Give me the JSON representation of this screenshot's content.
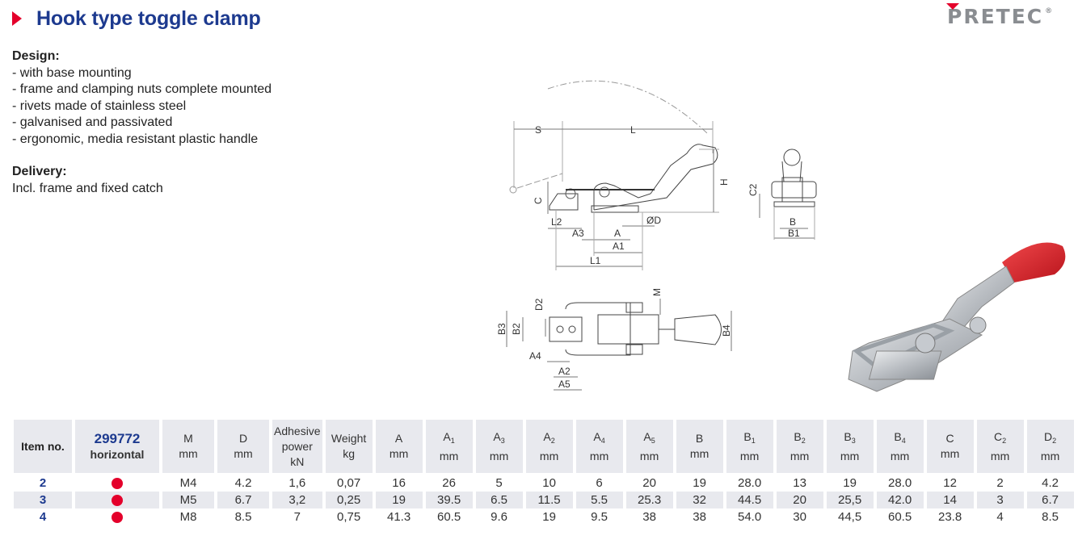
{
  "header": {
    "title": "Hook type toggle clamp",
    "brand": "PRETEC",
    "brand_mark": "®"
  },
  "colors": {
    "accent_red": "#e4002b",
    "title_blue": "#1d3a8f",
    "logo_gray": "#8a8d91",
    "header_cell_bg": "#e8e9ee"
  },
  "description": {
    "design_heading": "Design:",
    "design_items": [
      "- with base mounting",
      "- frame and clamping nuts complete mounted",
      "- rivets made of stainless steel",
      "- galvanised and passivated",
      "- ergonomic, media resistant plastic handle"
    ],
    "delivery_heading": "Delivery:",
    "delivery_text": "Incl. frame and fixed catch"
  },
  "drawing_labels": {
    "side": [
      "S",
      "L",
      "H",
      "C",
      "L2",
      "ØD",
      "A3",
      "A",
      "A1",
      "L1"
    ],
    "front": [
      "C2",
      "B",
      "B1"
    ],
    "top": [
      "M",
      "D2",
      "B3",
      "B2",
      "B4",
      "A4",
      "A2",
      "A5"
    ]
  },
  "table": {
    "columns": [
      {
        "name": "Item no.",
        "unit": "",
        "sub": ""
      },
      {
        "name": "299772",
        "unit": "horizontal",
        "sub": ""
      },
      {
        "name": "M",
        "unit": "mm",
        "sub": ""
      },
      {
        "name": "D",
        "unit": "mm",
        "sub": ""
      },
      {
        "name": "Adhesive power",
        "unit": "kN",
        "sub": ""
      },
      {
        "name": "Weight",
        "unit": "kg",
        "sub": ""
      },
      {
        "name": "A",
        "unit": "mm",
        "sub": ""
      },
      {
        "name": "A",
        "unit": "mm",
        "sub": "1"
      },
      {
        "name": "A",
        "unit": "mm",
        "sub": "3"
      },
      {
        "name": "A",
        "unit": "mm",
        "sub": "2"
      },
      {
        "name": "A",
        "unit": "mm",
        "sub": "4"
      },
      {
        "name": "A",
        "unit": "mm",
        "sub": "5"
      },
      {
        "name": "B",
        "unit": "mm",
        "sub": ""
      },
      {
        "name": "B",
        "unit": "mm",
        "sub": "1"
      },
      {
        "name": "B",
        "unit": "mm",
        "sub": "2"
      },
      {
        "name": "B",
        "unit": "mm",
        "sub": "3"
      },
      {
        "name": "B",
        "unit": "mm",
        "sub": "4"
      },
      {
        "name": "C",
        "unit": "mm",
        "sub": ""
      },
      {
        "name": "C",
        "unit": "mm",
        "sub": "2"
      },
      {
        "name": "D",
        "unit": "mm",
        "sub": "2"
      }
    ],
    "rows": [
      {
        "item": "2",
        "available": true,
        "values": [
          "M4",
          "4.2",
          "1,6",
          "0,07",
          "16",
          "26",
          "5",
          "10",
          "6",
          "20",
          "19",
          "28.0",
          "13",
          "19",
          "28.0",
          "12",
          "2",
          "4.2"
        ]
      },
      {
        "item": "3",
        "available": true,
        "values": [
          "M5",
          "6.7",
          "3,2",
          "0,25",
          "19",
          "39.5",
          "6.5",
          "11.5",
          "5.5",
          "25.3",
          "32",
          "44.5",
          "20",
          "25,5",
          "42.0",
          "14",
          "3",
          "6.7"
        ]
      },
      {
        "item": "4",
        "available": true,
        "values": [
          "M8",
          "8.5",
          "7",
          "0,75",
          "41.3",
          "60.5",
          "9.6",
          "19",
          "9.5",
          "38",
          "38",
          "54.0",
          "30",
          "44,5",
          "60.5",
          "23.8",
          "4",
          "8.5"
        ]
      }
    ]
  }
}
